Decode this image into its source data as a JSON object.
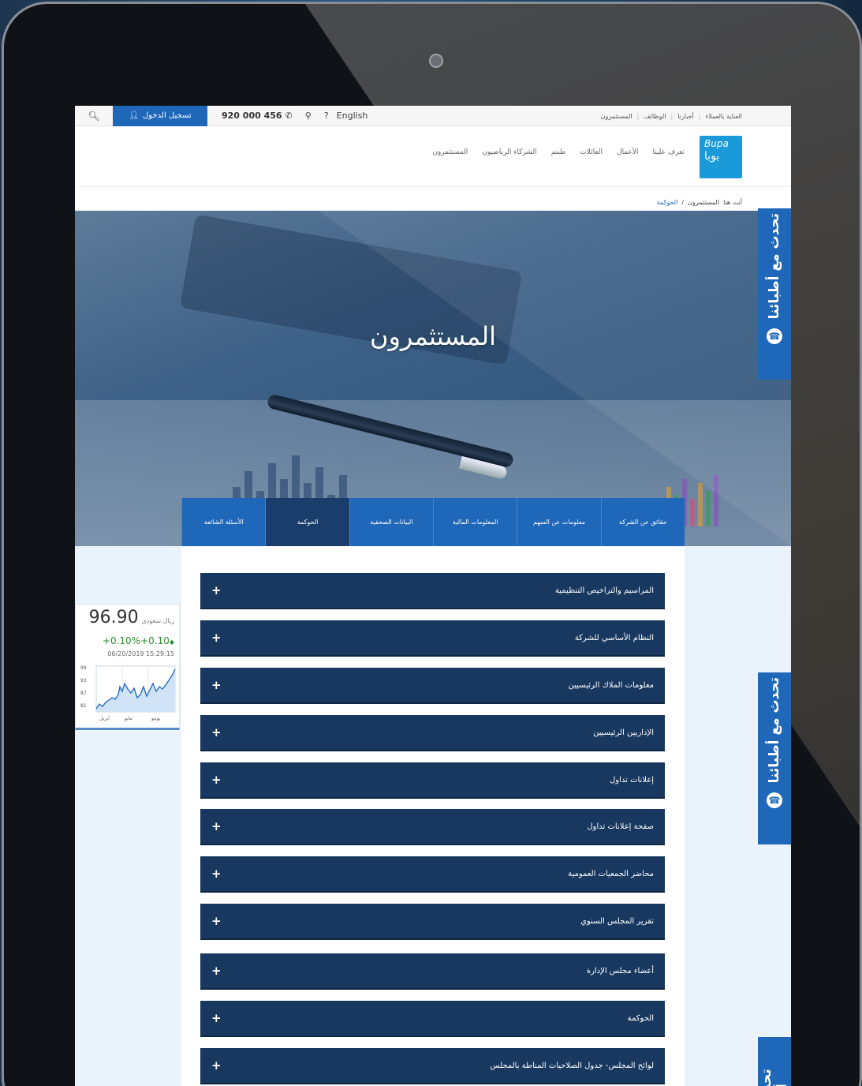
{
  "utility": {
    "login": "تسجيل الدخول",
    "phone": "920 000 456",
    "language": "English",
    "links": [
      "العناية بالعملاء",
      "أخبارنا",
      "الوظائف",
      "المستثمرون"
    ]
  },
  "logo": {
    "latin": "Bupa",
    "arabic": "بوبا"
  },
  "nav": [
    "تعرف علينا",
    "الأعمال",
    "العائلات",
    "طبتم",
    "الشركاء الرياضيون",
    "المستثمرون"
  ],
  "breadcrumb": {
    "prefix": "أنت هنا",
    "items": [
      "المستثمرون",
      "الحوكمة"
    ],
    "separator": "/"
  },
  "hero": {
    "title": "المستثمرون"
  },
  "tabs": [
    {
      "label": "حقائق عن الشركة",
      "active": false
    },
    {
      "label": "معلومات عن السهم",
      "active": false
    },
    {
      "label": "المعلومات المالية",
      "active": false
    },
    {
      "label": "البيانات الصحفية",
      "active": false
    },
    {
      "label": "الحوكمة",
      "active": true
    },
    {
      "label": "الأسئلة الشائعة",
      "active": false
    }
  ],
  "accordion": [
    "المراسيم والتراخيص التنظيمية",
    "النظام الأساسي للشركة",
    "معلومات الملاك الرئيسيين",
    "الإداريين الرئيسيين",
    "إعلانات تداول",
    "صفحة إعلانات تداول",
    "محاضر الجمعيات العمومية",
    "تقرير المجلس السنوي",
    "أعضاء مجلس الإدارة",
    "الحوكمة",
    "لوائح المجلس- جدول الصلاحيات المناطة بالمجلس"
  ],
  "stock": {
    "price": "96.90",
    "currency": "ريال سعودي",
    "change": "+0.10%+0.10",
    "datetime": "06/20/2019  15:29:15",
    "y_ticks": [
      "99",
      "93",
      "87",
      "81"
    ],
    "x_ticks": [
      "أبريل",
      "مايو",
      "يونيو"
    ]
  },
  "chat": {
    "label": "تحدث مع أطبائنا"
  },
  "colors": {
    "primary": "#1f67b8",
    "accordion": "#193860",
    "tab_active": "#1a3d6b",
    "positive": "#2e8b2e"
  }
}
